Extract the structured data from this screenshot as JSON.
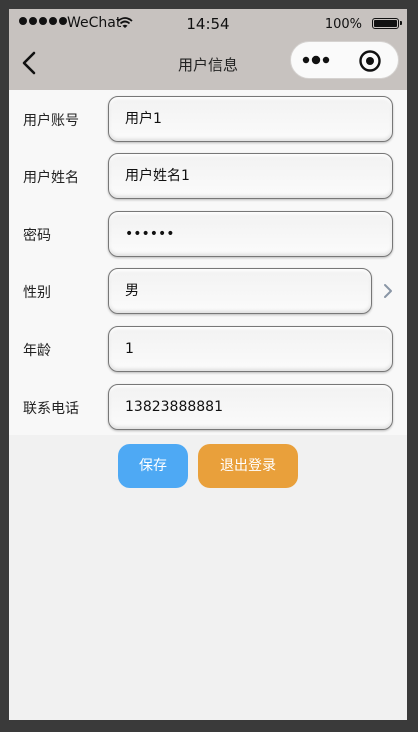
{
  "status_bar": {
    "carrier": "WeChat",
    "time": "14:54",
    "battery": "100%"
  },
  "nav": {
    "title": "用户信息",
    "back_icon": "chevron-left-icon",
    "menu_icon": "more-dots-icon",
    "close_icon": "target-circle-icon"
  },
  "form": {
    "account": {
      "label": "用户账号",
      "value": "用户1"
    },
    "name": {
      "label": "用户姓名",
      "value": "用户姓名1"
    },
    "password": {
      "label": "密码",
      "value": "••••••"
    },
    "gender": {
      "label": "性别",
      "value": "男"
    },
    "age": {
      "label": "年龄",
      "value": "1"
    },
    "phone": {
      "label": "联系电话",
      "value": "13823888881"
    }
  },
  "actions": {
    "save_label": "保存",
    "logout_label": "退出登录"
  },
  "colors": {
    "header_bg": "#c7c2bf",
    "save_button": "#4ea9f4",
    "logout_button": "#e9a03b"
  }
}
